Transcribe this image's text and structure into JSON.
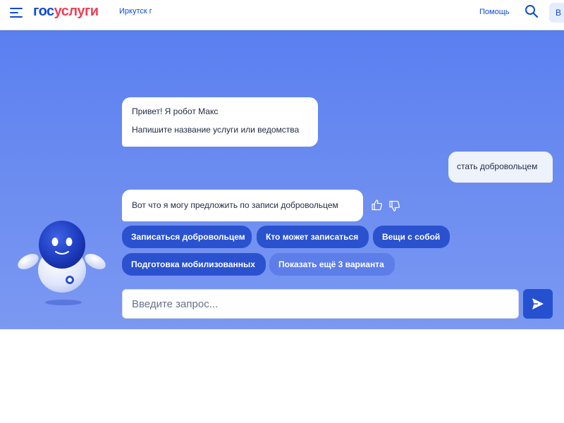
{
  "header": {
    "logo_part1": "гос",
    "logo_part2": "услуги",
    "city": "Иркутск г",
    "help_label": "Помощь",
    "login_label": "В"
  },
  "chat": {
    "bot_greeting_line1": "Привет! Я робот Макс",
    "bot_greeting_line2": "Напишите название услуги или ведомства",
    "user_message": "стать добровольцем",
    "bot_reply": "Вот что я могу предложить по записи добровольцем",
    "suggestions": [
      "Записаться добровольцем",
      "Кто может записаться",
      "Вещи с собой",
      "Подготовка мобилизованных",
      "Показать ещё 3 варианта"
    ]
  },
  "input": {
    "placeholder": "Введите запрос...",
    "value": ""
  },
  "icons": {
    "menu": "menu-icon",
    "search": "search-icon",
    "like": "thumbs-up-icon",
    "dislike": "thumbs-down-icon",
    "send": "send-icon",
    "mascot": "robot-mascot"
  },
  "colors": {
    "brand_blue": "#0d4cd3",
    "brand_red": "#ee3f58",
    "chip_dark": "#2a52cf",
    "chip_light": "#5d7ee9",
    "chat_bg": "#6a8bf0"
  }
}
